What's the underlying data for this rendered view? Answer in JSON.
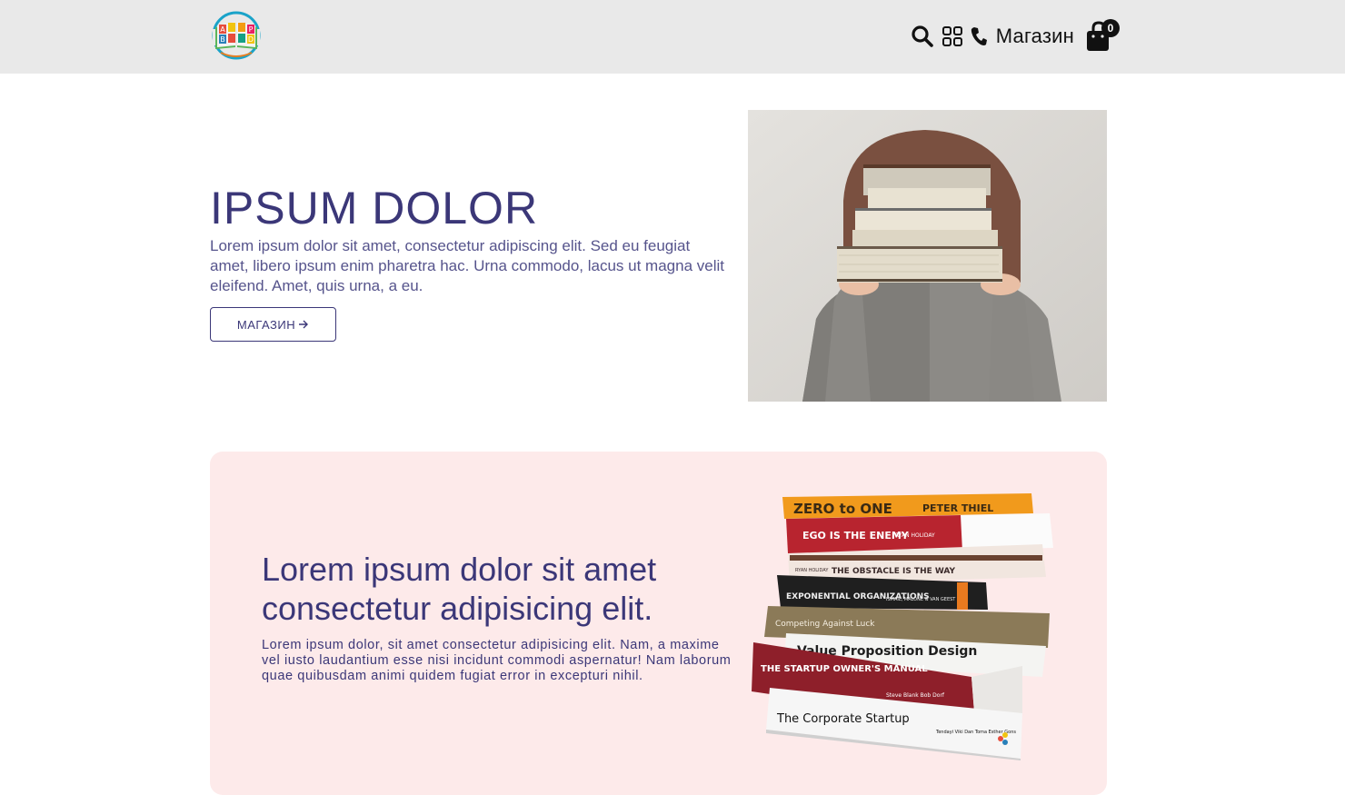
{
  "header": {
    "logo_letters": [
      "A",
      "P",
      "B",
      "D"
    ],
    "icons": [
      "search-icon",
      "grid-icon",
      "phone-icon",
      "shopping-bag-icon"
    ],
    "shop_label": "Магазин",
    "cart_count": "0"
  },
  "hero": {
    "title": "IPSUM DOLOR",
    "text": "Lorem ipsum dolor sit amet, consectetur adipiscing elit. Sed eu feugiat amet, libero ipsum enim pharetra hac. Urna commodo, lacus ut magna velit eleifend. Amet, quis urna, a eu.",
    "button_label": "МАГАЗИН",
    "button_icon": "arrow-right-icon"
  },
  "banner": {
    "title": "Lorem ipsum dolor sit amet consectetur adipisicing elit.",
    "text": "Lorem ipsum dolor, sit amet consectetur adipisicing elit. Nam, a maxime vel iusto laudantium esse nisi incidunt commodi aspernatur! Nam laborum quae quibusdam animi quidem fugiat error in excepturi nihil.",
    "books": [
      {
        "title": "ZERO to ONE",
        "author": "PETER THIEL"
      },
      {
        "title": "EGO IS THE ENEMY",
        "author": "RYAN HOLIDAY"
      },
      {
        "title": "THE OBSTACLE IS THE WAY",
        "author": "RYAN HOLIDAY"
      },
      {
        "title": "EXPONENTIAL ORGANIZATIONS",
        "author": "ISMAIL, MALONE & VAN GEEST"
      },
      {
        "title": "Competing Against Luck",
        "author": ""
      },
      {
        "title": "Value Proposition Design",
        "author": ""
      },
      {
        "title": "THE STARTUP OWNER'S MANUAL",
        "author": "Steve Blank Bob Dorf"
      },
      {
        "title": "The Corporate Startup",
        "author": "Tendayi Viki Dan Toma Esther Gons"
      }
    ]
  },
  "colors": {
    "header_bg": "#e9e9e9",
    "accent": "#3b3778",
    "banner_bg": "#fdeaea"
  }
}
